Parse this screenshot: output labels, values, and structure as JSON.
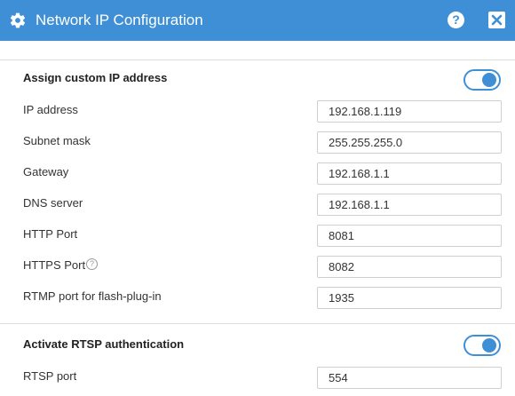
{
  "dialog": {
    "title": "Network IP Configuration",
    "help_glyph": "?",
    "accent_color": "#3f8fd6"
  },
  "custom_ip": {
    "heading": "Assign custom IP address",
    "enabled": true,
    "fields": [
      {
        "label": "IP address",
        "value": "192.168.1.119"
      },
      {
        "label": "Subnet mask",
        "value": "255.255.255.0"
      },
      {
        "label": "Gateway",
        "value": "192.168.1.1"
      },
      {
        "label": "DNS server",
        "value": "192.168.1.1"
      },
      {
        "label": "HTTP Port",
        "value": "8081"
      },
      {
        "label": "HTTPS Port",
        "value": "8082",
        "info_glyph": "?"
      },
      {
        "label": "RTMP port for flash-plug-in",
        "value": "1935"
      }
    ]
  },
  "rtsp": {
    "heading": "Activate RTSP authentication",
    "enabled": true,
    "fields": [
      {
        "label": "RTSP port",
        "value": "554"
      }
    ]
  }
}
